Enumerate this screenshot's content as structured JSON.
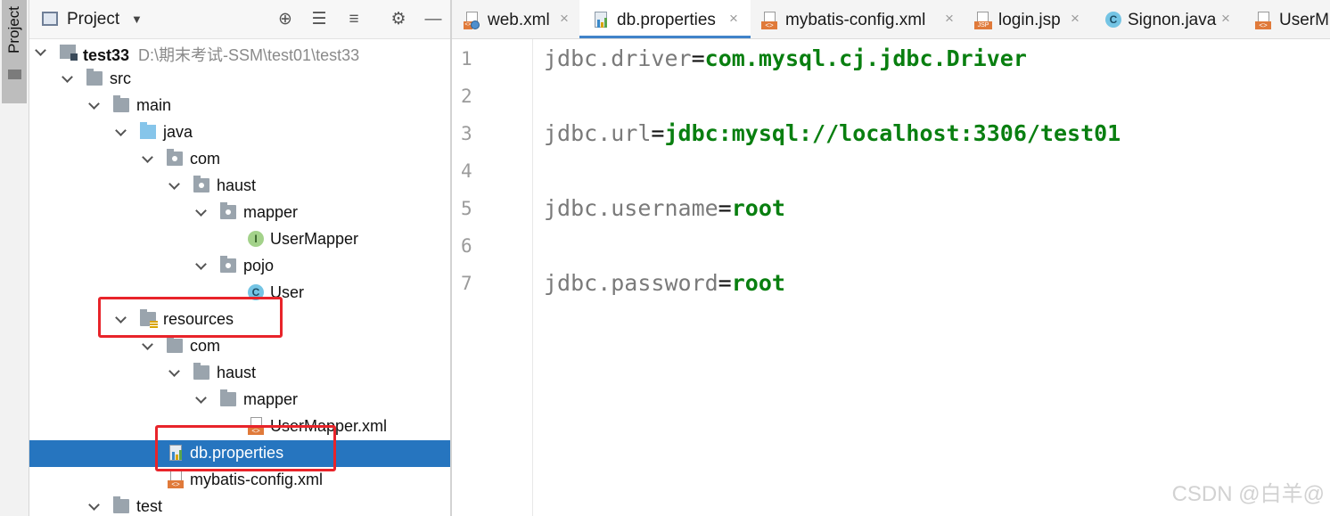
{
  "toolstrip": {
    "project_tab": "Project"
  },
  "project_panel": {
    "title": "Project",
    "header_icons": [
      "crosshair-icon",
      "expand-all-icon",
      "collapse-all-icon",
      "gear-icon",
      "minimize-icon"
    ]
  },
  "tree": {
    "root_name": "test33",
    "root_path": "D:\\期末考试-SSM\\test01\\test33",
    "src": "src",
    "main": "main",
    "java": "java",
    "com1": "com",
    "haust1": "haust",
    "mapper1": "mapper",
    "usermapper_iface": "UserMapper",
    "pojo": "pojo",
    "user_class": "User",
    "resources": "resources",
    "com2": "com",
    "haust2": "haust",
    "mapper2": "mapper",
    "usermapper_xml": "UserMapper.xml",
    "db_properties": "db.properties",
    "mybatis_config": "mybatis-config.xml",
    "test": "test"
  },
  "tabs": [
    {
      "label": "web.xml"
    },
    {
      "label": "db.properties"
    },
    {
      "label": "mybatis-config.xml"
    },
    {
      "label": "login.jsp"
    },
    {
      "label": "Signon.java"
    },
    {
      "label": "UserM"
    }
  ],
  "tab_close": "×",
  "editor": {
    "line_numbers": [
      "1",
      "2",
      "3",
      "4",
      "5",
      "6",
      "7"
    ],
    "lines": [
      {
        "key": "jdbc.driver",
        "eq": "=",
        "value": "com.mysql.cj.jdbc.Driver"
      },
      {
        "key": "jdbc.url",
        "eq": "=",
        "value": "jdbc:mysql://localhost:3306/test01"
      },
      {
        "key": "jdbc.username",
        "eq": "=",
        "value": "root"
      },
      {
        "key": "jdbc.password",
        "eq": "=",
        "value": "root"
      }
    ]
  },
  "watermark": "CSDN @白羊@",
  "colors": {
    "selection": "#2675bf",
    "highlight_box": "#e8242a",
    "value_green": "#097f10",
    "tab_underline": "#4083c9"
  }
}
